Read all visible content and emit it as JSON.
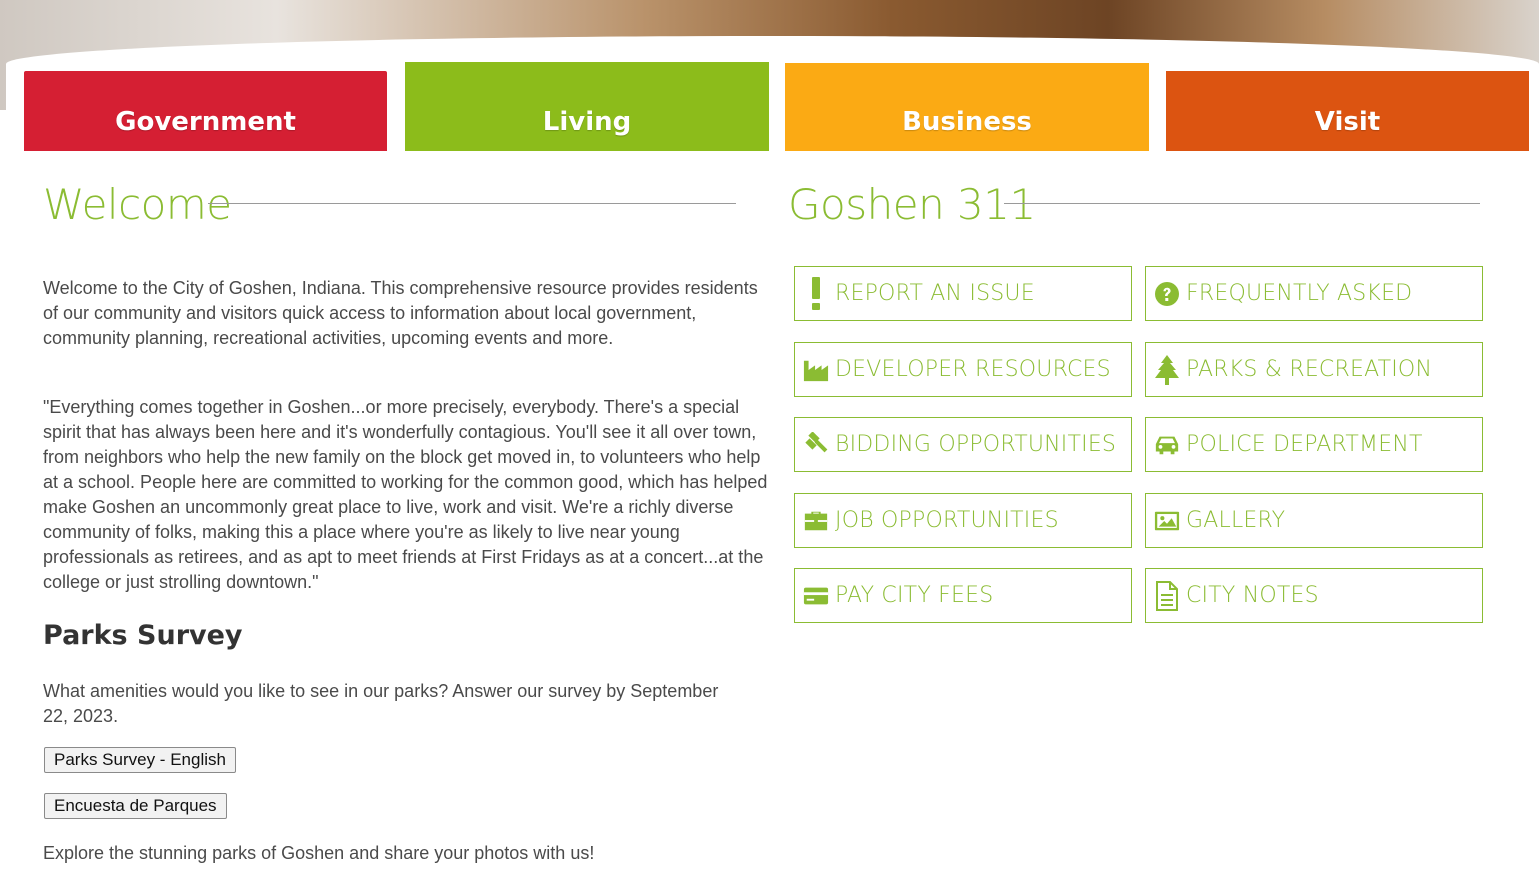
{
  "nav": {
    "tabs": [
      {
        "label": "Government",
        "color": "#d51f33"
      },
      {
        "label": "Living",
        "color": "#8cbc1b"
      },
      {
        "label": "Business",
        "color": "#fbaa14"
      },
      {
        "label": "Visit",
        "color": "#dc5411"
      }
    ]
  },
  "welcome": {
    "title": "Welcome",
    "intro": "Welcome to the City of Goshen, Indiana. This comprehensive resource provides residents of our community and visitors quick access to information about local government, community planning, recreational activities, upcoming events and more.",
    "quote": "\"Everything comes together in Goshen...or more precisely, everybody. There's a special spirit that has always been here and it's wonderfully contagious. You'll see it all over town, from neighbors who help the new family on the block get moved in, to volunteers who help at a school.  People here are committed to working for the common good, which has helped make Goshen an uncommonly great place to live, work and visit. We're a richly diverse community of folks, making this a place where you're as likely to live near young professionals as retirees, and as apt to meet friends at First Fridays as at a concert...at the college or just strolling downtown.\""
  },
  "survey": {
    "heading": "Parks Survey",
    "text": "What amenities would you like to see in our parks? Answer our survey by September 22, 2023.",
    "btn_english": "Parks Survey - English",
    "btn_spanish": "Encuesta de Parques",
    "footer": "Explore the stunning parks of Goshen and share your photos with us!"
  },
  "goshen311": {
    "title": "Goshen 311",
    "accent": "#8bbc33",
    "items": [
      {
        "label": "REPORT AN ISSUE",
        "icon": "exclamation-icon"
      },
      {
        "label": "FREQUENTLY ASKED",
        "icon": "question-circle-icon"
      },
      {
        "label": "DEVELOPER RESOURCES",
        "icon": "factory-icon"
      },
      {
        "label": "PARKS & RECREATION",
        "icon": "tree-icon"
      },
      {
        "label": "BIDDING OPPORTUNITIES",
        "icon": "gavel-icon"
      },
      {
        "label": "POLICE DEPARTMENT",
        "icon": "car-icon"
      },
      {
        "label": "JOB OPPORTUNITIES",
        "icon": "briefcase-icon"
      },
      {
        "label": "GALLERY",
        "icon": "image-icon"
      },
      {
        "label": "PAY CITY FEES",
        "icon": "credit-card-icon"
      },
      {
        "label": "CITY NOTES",
        "icon": "document-icon"
      }
    ]
  }
}
